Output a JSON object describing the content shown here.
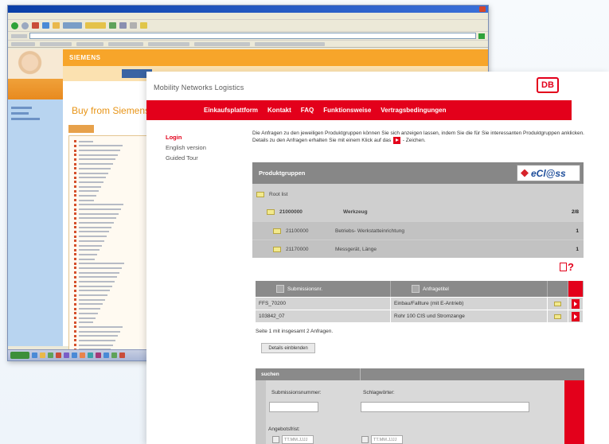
{
  "background_window": {
    "brand_text": "SIEMENS",
    "heading": "Buy from Siemens",
    "list_item_count": 52,
    "colors": {
      "orange": "#f7a52a",
      "sidebar_blue": "#b8d4f0"
    }
  },
  "foreground": {
    "site_title": "Mobility Networks Logistics",
    "logo_text": "DB",
    "nav": [
      {
        "label": "Einkaufsplattform"
      },
      {
        "label": "Kontakt"
      },
      {
        "label": "FAQ"
      },
      {
        "label": "Funktionsweise"
      },
      {
        "label": "Vertragsbedingungen"
      }
    ],
    "left_menu": {
      "login": "Login",
      "english": "English version",
      "tour": "Guided Tour"
    },
    "intro": {
      "line1": "Die Anfragen zu den jeweiligen Produktgruppen können Sie sich anzeigen lassen, indem Sie die für Sie interessanten Produktgruppen anklicken.",
      "line2a": "Details zu den Anfragen erhalten Sie mit einem Klick auf das",
      "line2b": "- Zeichen."
    },
    "produktgruppen": {
      "title": "Produktgruppen",
      "eclass_label": "eCl@ss",
      "root": "Root list",
      "rows": [
        {
          "code": "21000000",
          "name": "Werkzeug",
          "count": "2/8"
        },
        {
          "code": "21100000",
          "name": "Betriebs- Werkstatteinrichtung",
          "count": "1"
        },
        {
          "code": "21170000",
          "name": "Messgerät, Länge",
          "count": "1"
        }
      ]
    },
    "anfragen": {
      "col_submission": "Submissionsnr.",
      "col_title": "Anfragetitel",
      "rows": [
        {
          "nr": "FFS_70200",
          "titel": "Einbau/Fallture (mit E-Antrieb)"
        },
        {
          "nr": "103842_07",
          "titel": "Rohr 100 CIS und Stromzange"
        }
      ]
    },
    "pager": "Seite 1 mit insgesamt 2 Anfragen.",
    "details_button": "Details einblenden",
    "suchen": {
      "title": "suchen",
      "field_submission_label": "Submissionsnummer:",
      "field_keyword_label": "Schlagwörter:",
      "deadline_label": "Angebotsfrist:",
      "date_from_placeholder": "TT.MM.JJJJ",
      "date_to_placeholder": "TT.MM.JJJJ"
    },
    "colors": {
      "db_red": "#e3001b",
      "panel_grey": "#878787"
    }
  }
}
